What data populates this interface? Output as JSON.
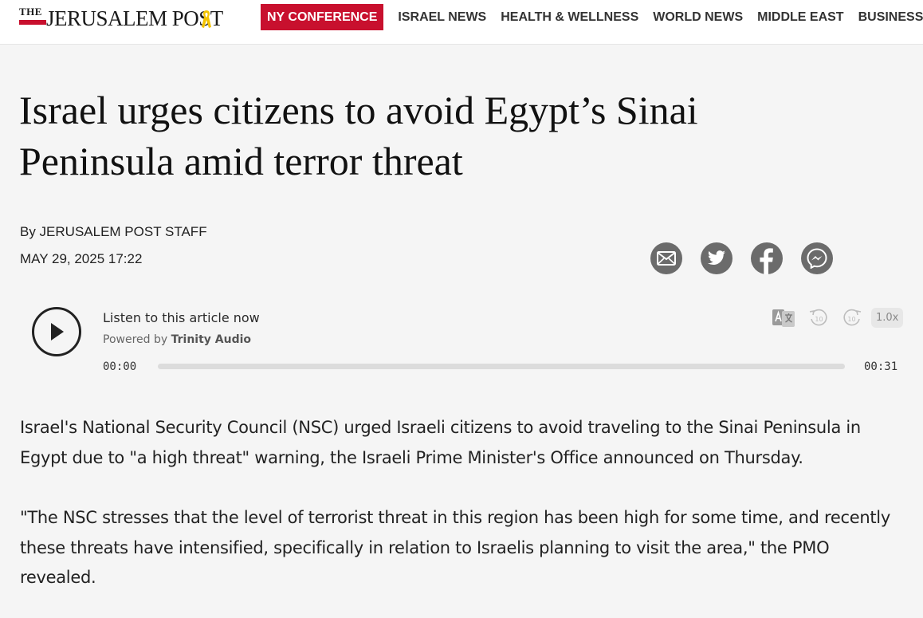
{
  "header": {
    "logo_the": "THE",
    "logo_name": "JERUSALEM POST",
    "nav_highlight": "NY CONFERENCE",
    "nav_items": [
      "ISRAEL NEWS",
      "HEALTH & WELLNESS",
      "WORLD NEWS",
      "MIDDLE EAST",
      "BUSINESS &"
    ],
    "accent_color": "#c8102e"
  },
  "article": {
    "headline": "Israel urges citizens to avoid Egypt’s Sinai Peninsula amid terror threat",
    "byline": "By JERUSALEM POST STAFF",
    "date": "MAY 29, 2025 17:22",
    "share_icons": [
      "mail-icon",
      "twitter-icon",
      "facebook-icon",
      "messenger-icon"
    ],
    "paragraphs": [
      "Israel's National Security Council (NSC) urged Israeli citizens to avoid traveling to the Sinai Peninsula in Egypt due to \"a high threat\" warning, the Israeli Prime Minister's Office announced on Thursday.",
      "\"The NSC stresses that the level of terrorist threat in this region has been high for some time, and recently these threats have intensified, specifically in relation to Israelis planning to visit the area,\" the PMO revealed."
    ]
  },
  "player": {
    "title": "Listen to this article now",
    "powered_prefix": "Powered by",
    "powered_brand": "Trinity Audio",
    "time_current": "00:00",
    "time_total": "00:31",
    "speed": "1.0x",
    "progress": 0
  }
}
